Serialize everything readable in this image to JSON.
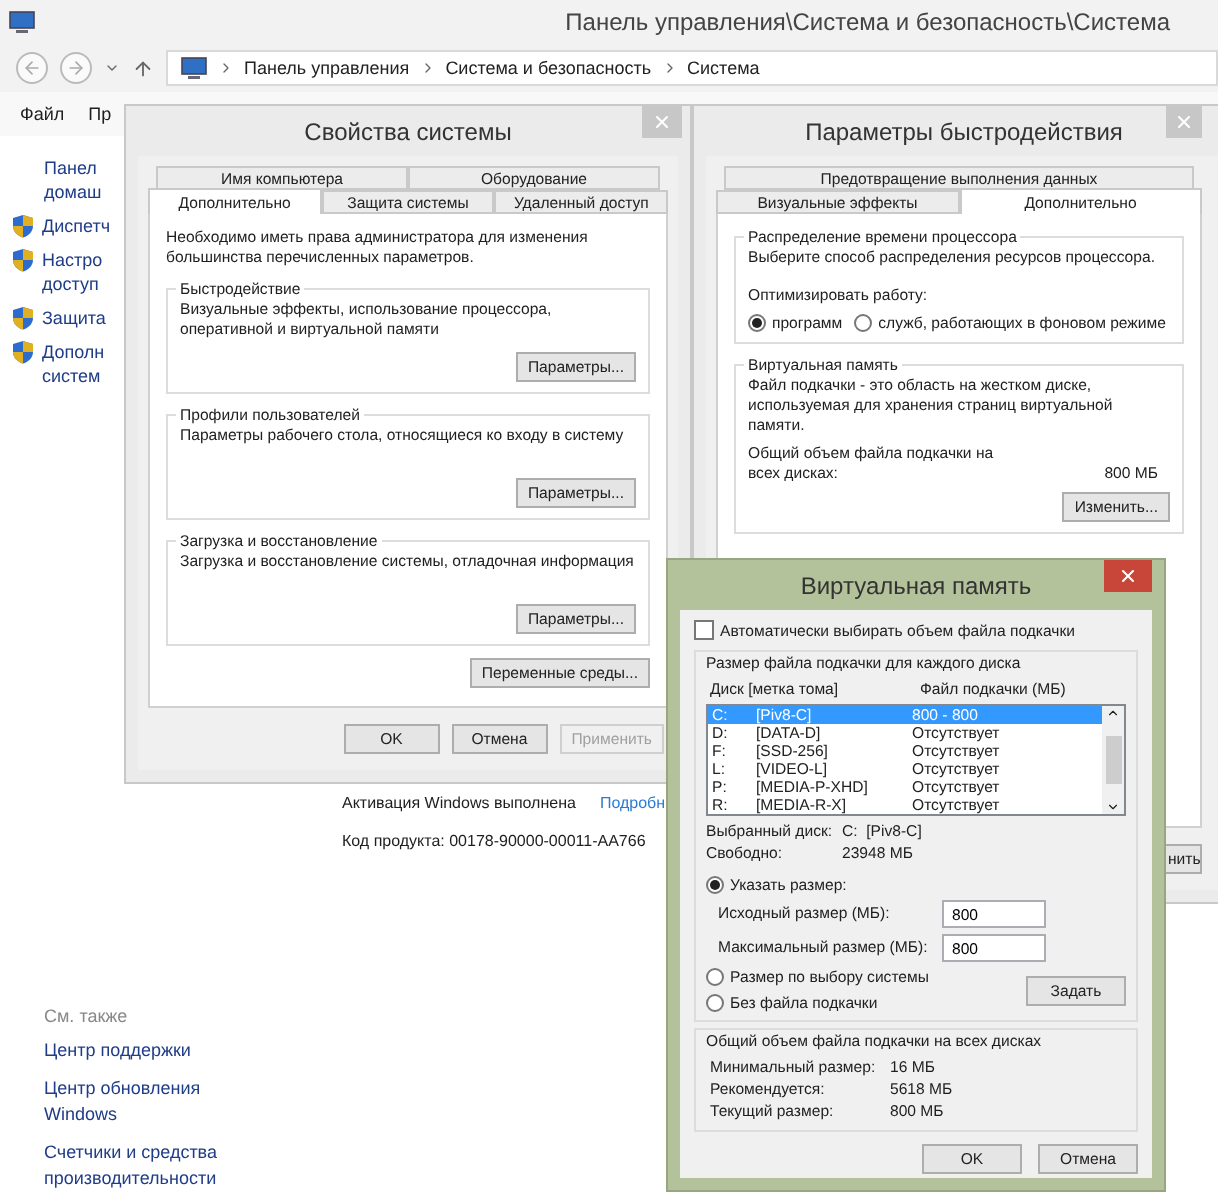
{
  "explorer": {
    "title": "Панель управления\\Система и безопасность\\Система",
    "breadcrumb": [
      "Панель управления",
      "Система и безопасность",
      "Система"
    ],
    "menu": [
      "Файл",
      "Пр"
    ],
    "sidebar": [
      {
        "kind": "link",
        "lines": [
          "Панел",
          "домаш"
        ]
      },
      {
        "kind": "shield",
        "lines": [
          "Диспетч"
        ]
      },
      {
        "kind": "shield",
        "lines": [
          "Настро",
          "доступ"
        ]
      },
      {
        "kind": "shield",
        "lines": [
          "Защита"
        ]
      },
      {
        "kind": "shield",
        "lines": [
          "Дополн",
          "систем"
        ]
      }
    ],
    "activation": {
      "text": "Активация Windows выполнена",
      "link": "Подробн"
    },
    "product_code": "Код продукта: 00178-90000-00011-AA766",
    "see_also": {
      "heading": "См. также",
      "links": [
        "Центр поддержки",
        "Центр обновления Windows",
        "Счетчики и средства производительности"
      ]
    }
  },
  "system_properties": {
    "title": "Свойства системы",
    "tab_rows": [
      {
        "tabs": [
          {
            "label": "Имя компьютера",
            "selected": false
          },
          {
            "label": "Оборудование",
            "selected": false
          }
        ]
      },
      {
        "tabs": [
          {
            "label": "Дополнительно",
            "selected": true
          },
          {
            "label": "Защита системы",
            "selected": false
          },
          {
            "label": "Удаленный доступ",
            "selected": false
          }
        ]
      }
    ],
    "note": "Необходимо иметь права администратора для изменения большинства перечисленных параметров.",
    "groups": [
      {
        "title": "Быстродействие",
        "text": "Визуальные эффекты, использование процессора, оперативной и виртуальной памяти",
        "button": "Параметры..."
      },
      {
        "title": "Профили пользователей",
        "text": "Параметры рабочего стола, относящиеся ко входу в систему",
        "button": "Параметры..."
      },
      {
        "title": "Загрузка и восстановление",
        "text": "Загрузка и восстановление системы, отладочная информация",
        "button": "Параметры..."
      }
    ],
    "env_button": "Переменные среды...",
    "buttons": [
      {
        "label": "OK",
        "disabled": false
      },
      {
        "label": "Отмена",
        "disabled": false
      },
      {
        "label": "Применить",
        "disabled": true
      }
    ]
  },
  "performance_options": {
    "title": "Параметры быстродействия",
    "tab_rows": [
      {
        "tabs": [
          {
            "label": "Предотвращение выполнения данных",
            "selected": false
          }
        ]
      },
      {
        "tabs": [
          {
            "label": "Визуальные эффекты",
            "selected": false
          },
          {
            "label": "Дополнительно",
            "selected": true
          }
        ]
      }
    ],
    "cpu": {
      "title": "Распределение времени процессора",
      "text": "Выберите способ распределения ресурсов процессора.",
      "optimize_label": "Оптимизировать работу:",
      "options": [
        {
          "label": "программ",
          "selected": true
        },
        {
          "label": "служб, работающих в фоновом режиме",
          "selected": false
        }
      ]
    },
    "virtual_memory": {
      "title": "Виртуальная память",
      "text": "Файл подкачки - это область на жестком диске, используемая для хранения страниц виртуальной памяти.",
      "total_label": "Общий объем файла подкачки на всех дисках:",
      "total_value": "800 МБ",
      "button": "Изменить..."
    },
    "bottom_button": "нить"
  },
  "virtual_memory": {
    "title": "Виртуальная память",
    "auto": {
      "label": "Автоматически выбирать объем файла подкачки",
      "checked": false
    },
    "group_title": "Размер файла подкачки для каждого диска",
    "columns": [
      "Диск [метка тома]",
      "Файл подкачки (МБ)"
    ],
    "drives": [
      {
        "drive": "C:",
        "label": "[Piv8-C]",
        "size": "800 - 800",
        "selected": true
      },
      {
        "drive": "D:",
        "label": "[DATA-D]",
        "size": "Отсутствует",
        "selected": false
      },
      {
        "drive": "F:",
        "label": "[SSD-256]",
        "size": "Отсутствует",
        "selected": false
      },
      {
        "drive": "L:",
        "label": "[VIDEO-L]",
        "size": "Отсутствует",
        "selected": false
      },
      {
        "drive": "P:",
        "label": "[MEDIA-P-XHD]",
        "size": "Отсутствует",
        "selected": false
      },
      {
        "drive": "R:",
        "label": "[MEDIA-R-X]",
        "size": "Отсутствует",
        "selected": false
      }
    ],
    "selected_disk": {
      "label": "Выбранный диск:",
      "value": "C:  [Piv8-C]"
    },
    "free": {
      "label": "Свободно:",
      "value": "23948 МБ"
    },
    "custom": {
      "label": "Указать размер:",
      "selected": true
    },
    "fields": [
      {
        "label": "Исходный размер (МБ):",
        "value": "800"
      },
      {
        "label": "Максимальный размер (МБ):",
        "value": "800"
      }
    ],
    "other_options": [
      {
        "label": "Размер по выбору системы",
        "selected": false
      },
      {
        "label": "Без файла подкачки",
        "selected": false
      }
    ],
    "set_button": "Задать",
    "totals_title": "Общий объем файла подкачки на всех дисках",
    "totals": [
      {
        "label": "Минимальный размер:",
        "value": "16 МБ"
      },
      {
        "label": "Рекомендуется:",
        "value": "5618 МБ"
      },
      {
        "label": "Текущий размер:",
        "value": "800 МБ"
      }
    ],
    "buttons": [
      "OK",
      "Отмена"
    ]
  }
}
